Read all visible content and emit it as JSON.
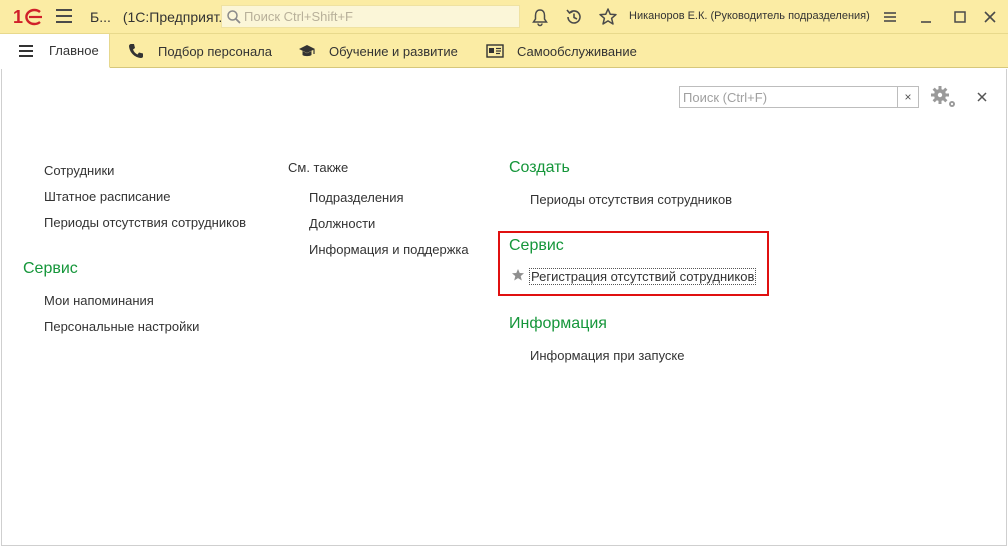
{
  "window": {
    "title_short": "Б...",
    "title_app": "(1С:Предприят...",
    "user": "Никаноров Е.К. (Руководитель подразделения)"
  },
  "global_search": {
    "placeholder": "Поиск Ctrl+Shift+F"
  },
  "sections": [
    {
      "label": "Главное",
      "icon": "hamburger-icon",
      "active": true
    },
    {
      "label": "Подбор персонала",
      "icon": "phone-icon"
    },
    {
      "label": "Обучение и развитие",
      "icon": "graduation-cap-icon"
    },
    {
      "label": "Самообслуживание",
      "icon": "id-card-icon"
    }
  ],
  "panel_search": {
    "placeholder": "Поиск (Ctrl+F)",
    "clear": "×"
  },
  "column1": {
    "links": [
      "Сотрудники",
      "Штатное расписание",
      "Периоды отсутствия сотрудников"
    ],
    "service_title": "Сервис",
    "service_links": [
      "Мои напоминания",
      "Персональные настройки"
    ]
  },
  "column2": {
    "see_also": "См. также",
    "links": [
      "Подразделения",
      "Должности",
      "Информация и поддержка"
    ]
  },
  "column3": {
    "create_title": "Создать",
    "create_links": [
      "Периоды отсутствия сотрудников"
    ],
    "service_title": "Сервис",
    "service_links": [
      "Регистрация отсутствий сотрудников"
    ],
    "info_title": "Информация",
    "info_links": [
      "Информация при запуске"
    ]
  },
  "colors": {
    "accent_bar": "#fbeca4",
    "group_title": "#15963a",
    "highlight": "#e01010",
    "logo": "#d0202a"
  }
}
